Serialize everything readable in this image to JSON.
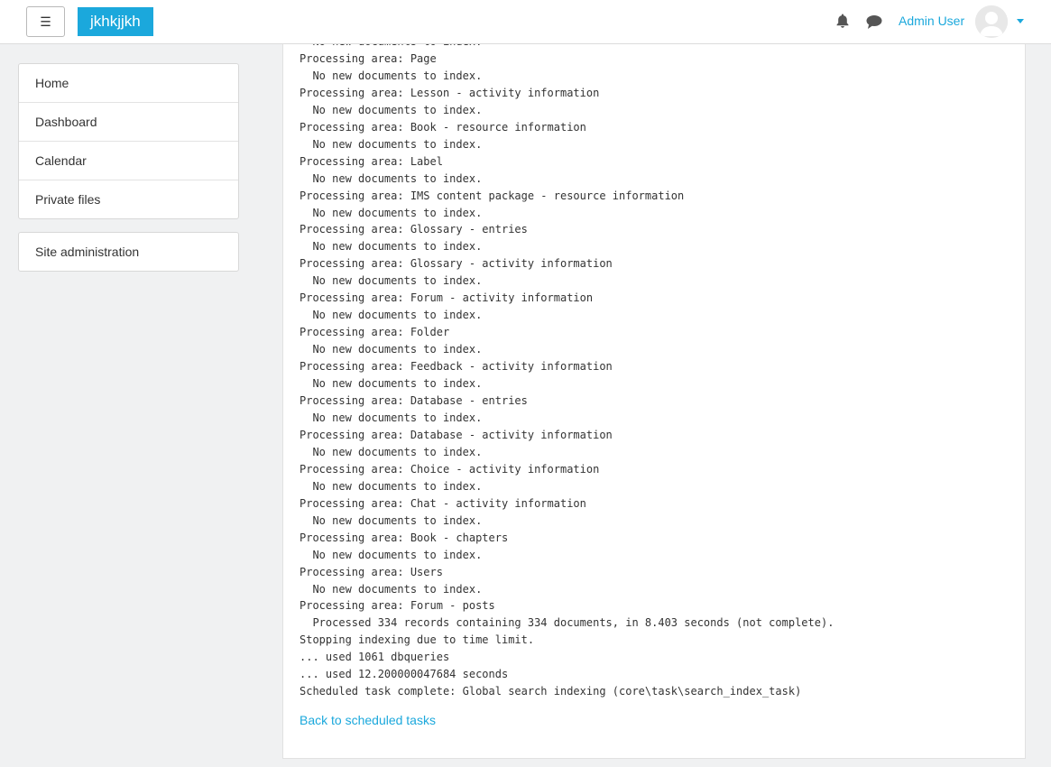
{
  "header": {
    "menu_icon": "☰",
    "brand": "jkhkjjkh",
    "notifications_icon": "bell-icon",
    "messages_icon": "chat-icon",
    "user_name": "Admin User"
  },
  "sidebar": {
    "items": [
      {
        "label": "Home"
      },
      {
        "label": "Dashboard"
      },
      {
        "label": "Calendar"
      },
      {
        "label": "Private files"
      }
    ],
    "admin": {
      "label": "Site administration"
    }
  },
  "log_lines": [
    "  No new documents to index.",
    "Processing area: Page",
    "  No new documents to index.",
    "Processing area: Lesson - activity information",
    "  No new documents to index.",
    "Processing area: Book - resource information",
    "  No new documents to index.",
    "Processing area: Label",
    "  No new documents to index.",
    "Processing area: IMS content package - resource information",
    "  No new documents to index.",
    "Processing area: Glossary - entries",
    "  No new documents to index.",
    "Processing area: Glossary - activity information",
    "  No new documents to index.",
    "Processing area: Forum - activity information",
    "  No new documents to index.",
    "Processing area: Folder",
    "  No new documents to index.",
    "Processing area: Feedback - activity information",
    "  No new documents to index.",
    "Processing area: Database - entries",
    "  No new documents to index.",
    "Processing area: Database - activity information",
    "  No new documents to index.",
    "Processing area: Choice - activity information",
    "  No new documents to index.",
    "Processing area: Chat - activity information",
    "  No new documents to index.",
    "Processing area: Book - chapters",
    "  No new documents to index.",
    "Processing area: Users",
    "  No new documents to index.",
    "Processing area: Forum - posts",
    "  Processed 334 records containing 334 documents, in 8.403 seconds (not complete).",
    "Stopping indexing due to time limit.",
    "... used 1061 dbqueries",
    "... used 12.200000047684 seconds",
    "Scheduled task complete: Global search indexing (core\\task\\search_index_task)"
  ],
  "back_link": "Back to scheduled tasks",
  "colors": {
    "accent": "#1ba8dc",
    "background": "#f0f1f2"
  }
}
